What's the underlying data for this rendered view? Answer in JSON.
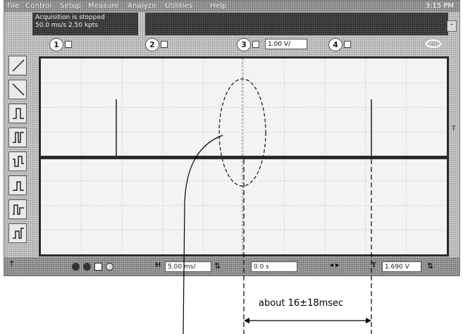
{
  "menu": [
    "File",
    "Control",
    "Setup",
    "Measure",
    "Analyze",
    "Utilities",
    "Help"
  ],
  "clock": "3:15 PM",
  "acquisition": {
    "line1": "Acquisition is stopped",
    "line2": "50.0 ms/s   2.50 kpts"
  },
  "channels": {
    "ch1": "1",
    "ch2": "2",
    "ch3": "3",
    "ch4": "4",
    "ch3_scale": "1.00 V/"
  },
  "side_marker": "T",
  "bottom": {
    "horizontal_tag": "H",
    "timebase": "5.00 ms/",
    "delay": "0.0 s",
    "trigger_tag": "T",
    "trigger_level": "1.690 V"
  },
  "annotation": {
    "measurement": "about 16±18msec"
  },
  "colors": {
    "trace": "#2a2a2a",
    "annotation": "#000000"
  }
}
